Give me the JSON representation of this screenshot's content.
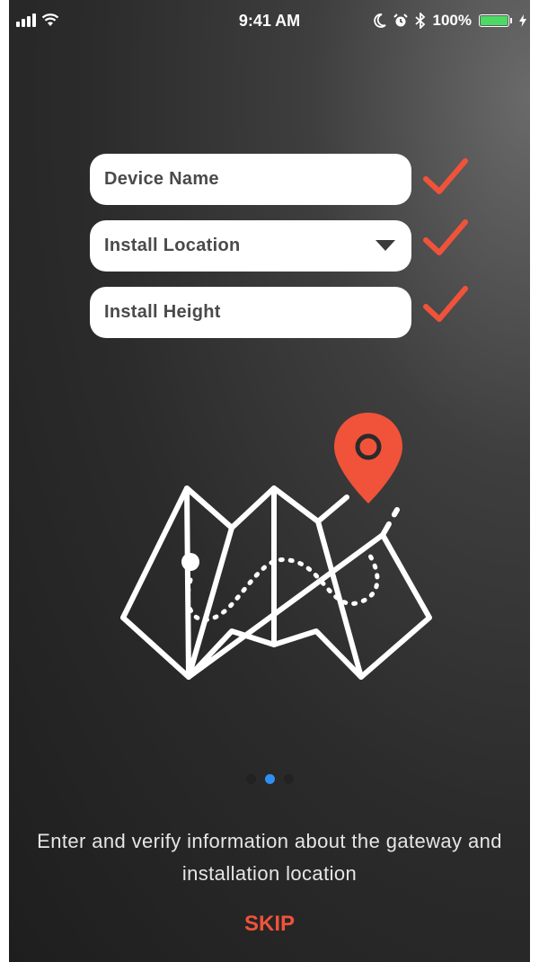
{
  "status_bar": {
    "time": "9:41 AM",
    "battery_percent": "100%",
    "icons": [
      "signal-icon",
      "wifi-icon",
      "moon-icon",
      "alarm-icon",
      "bluetooth-icon",
      "battery-icon",
      "charging-icon"
    ]
  },
  "form": {
    "fields": [
      {
        "label": "Device Name",
        "verified": true
      },
      {
        "label": "Install Location",
        "verified": true,
        "type": "dropdown"
      },
      {
        "label": "Install Height",
        "verified": true
      }
    ]
  },
  "illustration": {
    "name": "map-with-location-pin",
    "colors": {
      "lines": "#ffffff",
      "pin": "#f0533a"
    }
  },
  "pagination": {
    "total": 3,
    "active_index": 1
  },
  "description": "Enter and verify information about the gateway and installation location",
  "skip_label": "SKIP",
  "colors": {
    "accent": "#f0533a",
    "active_dot": "#2f8ff0",
    "background": "#2b2b2b"
  }
}
